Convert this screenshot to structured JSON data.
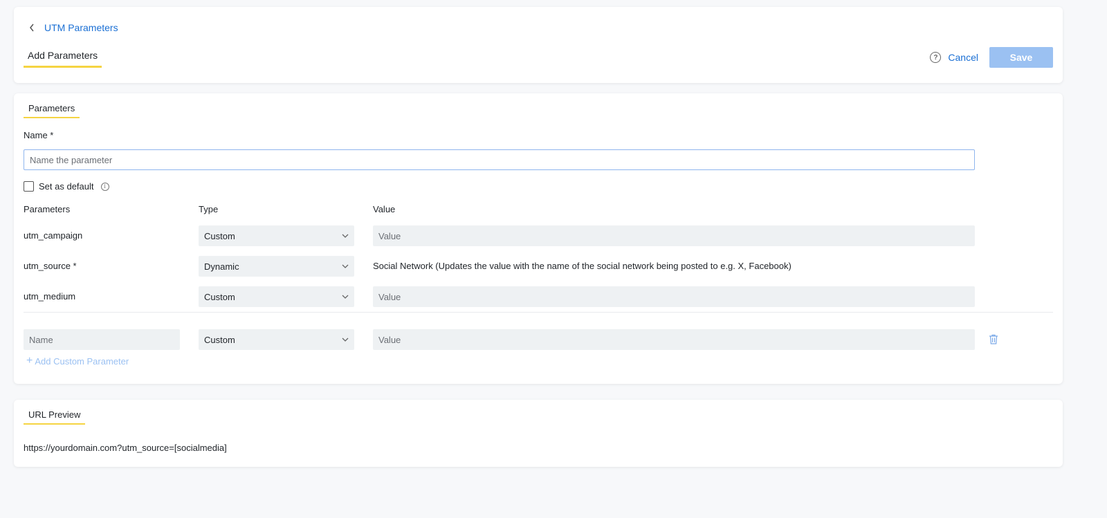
{
  "header": {
    "back_label": "UTM Parameters",
    "tab_title": "Add Parameters",
    "cancel_label": "Cancel",
    "save_label": "Save"
  },
  "parameters_section": {
    "title": "Parameters",
    "name_label": "Name *",
    "name_placeholder": "Name the parameter",
    "set_default_label": "Set as default",
    "columns": {
      "parameters": "Parameters",
      "type": "Type",
      "value": "Value"
    },
    "rows": [
      {
        "name": "utm_campaign",
        "type": "Custom",
        "value_placeholder": "Value"
      },
      {
        "name": "utm_source *",
        "type": "Dynamic",
        "value_text": "Social Network (Updates the value with the name of the social network being posted to e.g. X, Facebook)"
      },
      {
        "name": "utm_medium",
        "type": "Custom",
        "value_placeholder": "Value"
      }
    ],
    "custom_row": {
      "name_placeholder": "Name",
      "type": "Custom",
      "value_placeholder": "Value"
    },
    "add_custom_label": "Add Custom Parameter"
  },
  "url_preview": {
    "title": "URL Preview",
    "url": "https://yourdomain.com?utm_source=[socialmedia]"
  },
  "colors": {
    "accent_blue": "#1a6fd4",
    "disabled_blue": "#9bc1f2",
    "tab_underline": "#f5d442",
    "field_bg": "#eef1f3",
    "page_bg": "#f7f8fa"
  },
  "icons": {
    "back": "chevron-left-icon",
    "help": "question-circle-icon",
    "info": "info-icon",
    "dropdown": "chevron-down-icon",
    "delete": "trash-icon",
    "add": "plus-icon"
  }
}
